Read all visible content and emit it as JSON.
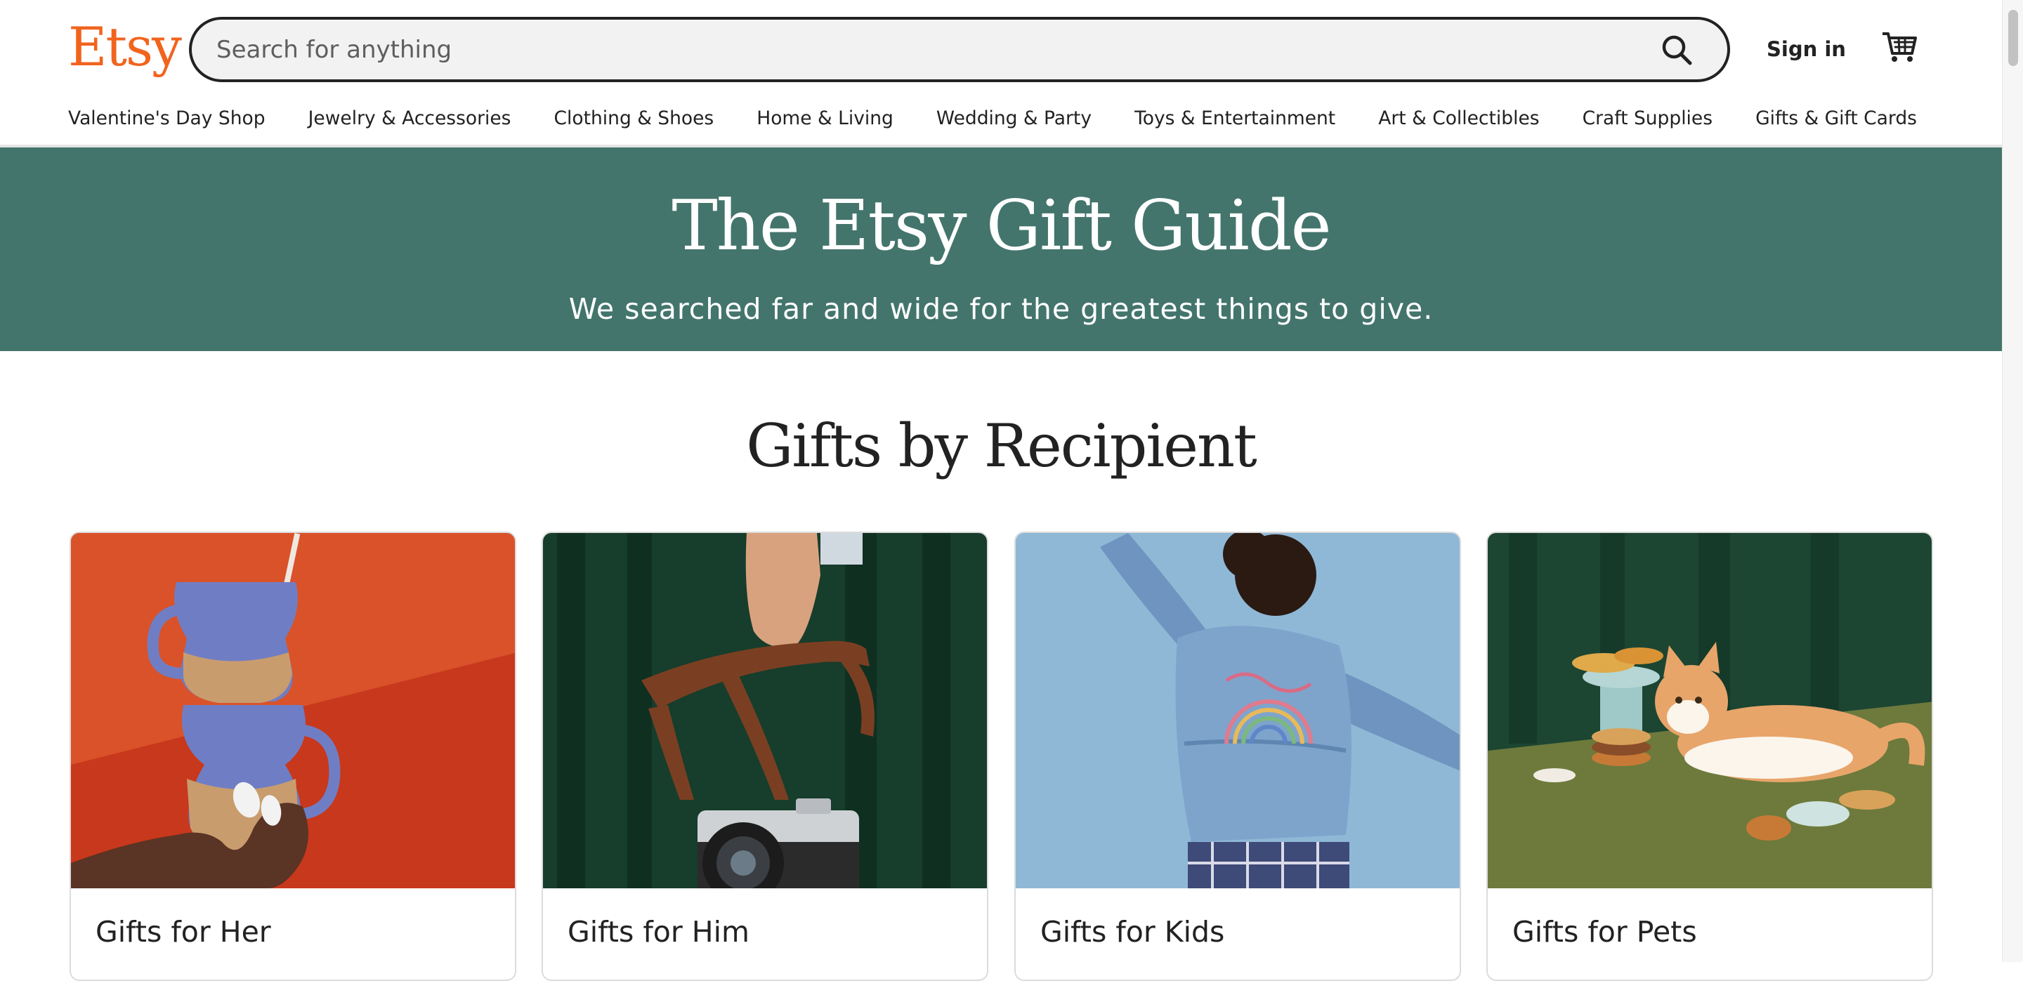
{
  "header": {
    "logo": "Etsy",
    "search_placeholder": "Search for anything",
    "search_value": "",
    "sign_in": "Sign in"
  },
  "categories": [
    "Valentine's Day Shop",
    "Jewelry & Accessories",
    "Clothing & Shoes",
    "Home & Living",
    "Wedding & Party",
    "Toys & Entertainment",
    "Art & Collectibles",
    "Craft Supplies",
    "Gifts & Gift Cards"
  ],
  "banner": {
    "title": "The Etsy Gift Guide",
    "subtitle": "We searched far and wide for the greatest things to give."
  },
  "section": {
    "title": "Gifts by Recipient",
    "cards": [
      {
        "label": "Gifts for Her"
      },
      {
        "label": "Gifts for Him"
      },
      {
        "label": "Gifts for Kids"
      },
      {
        "label": "Gifts for Pets"
      }
    ]
  },
  "colors": {
    "brand_orange": "#f1641e",
    "banner_green": "#43756c",
    "text": "#222222"
  },
  "icons": {
    "search": "search-icon",
    "cart": "cart-icon"
  }
}
